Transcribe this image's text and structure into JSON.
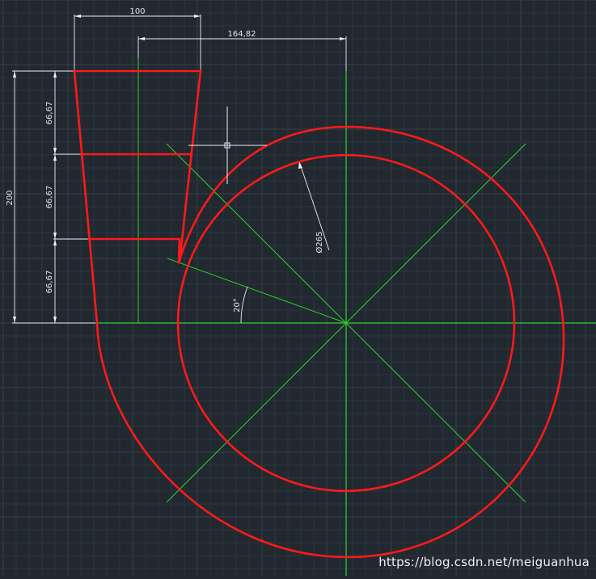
{
  "drawing": {
    "colors": {
      "background": "#212830",
      "grid_minor": "#2b333b",
      "grid_major": "#394149",
      "geometry": "#ff1a1a",
      "centerline": "#2fd12f",
      "dimension": "#f0f0f0"
    },
    "dimensions": {
      "top_width": "100",
      "center_offset": "164,82",
      "total_height": "200",
      "segment_top": "66,67",
      "segment_mid": "66,67",
      "segment_bottom": "66,67",
      "diameter": "Ø265",
      "angle": "20°"
    },
    "watermark": "https://blog.csdn.net/meiguanhua"
  }
}
